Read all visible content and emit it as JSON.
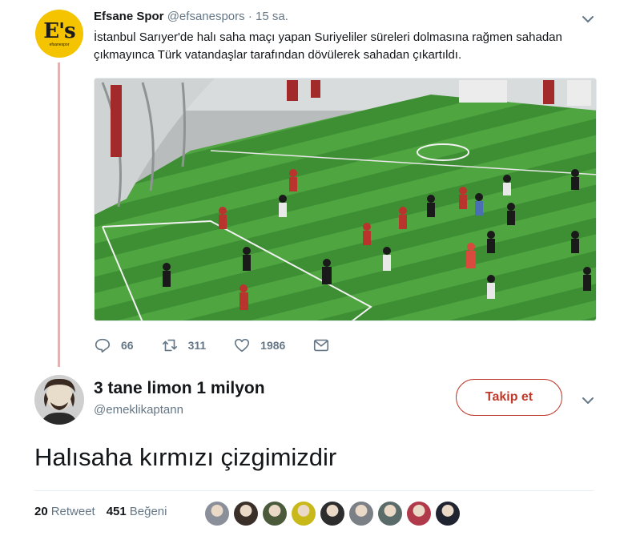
{
  "parent_tweet": {
    "avatar_logo": "E's",
    "avatar_logo_sub": "efsanespor",
    "display_name": "Efsane Spor",
    "handle": "@efsanespors",
    "separator": "·",
    "time": "15 sa.",
    "text": "İstanbul Sarıyer'de halı saha maçı yapan Suriyeliler süreleri dolmasına rağmen sahadan çıkmayınca Türk vatandaşlar tarafından dövülerek sahadan çıkartıldı.",
    "media_icon": "football-field-video-still",
    "actions": {
      "reply_count": "66",
      "retweet_count": "311",
      "like_count": "1986"
    },
    "thread_line_color": "#e2b3b3"
  },
  "main_tweet": {
    "display_name": "3 tane limon 1 milyon",
    "handle": "@emeklikaptann",
    "follow_label": "Takip et",
    "text": "Halısaha kırmızı çizgimizdir",
    "retweet_count": "20",
    "retweet_label": "Retweet",
    "like_count": "451",
    "like_label": "Beğeni",
    "accent_color": "#c0392b",
    "likers": [
      {
        "color": "#8a8f99"
      },
      {
        "color": "#3b2f2a"
      },
      {
        "color": "#4a5a3a"
      },
      {
        "color": "#c9b81a"
      },
      {
        "color": "#2d2d2d"
      },
      {
        "color": "#7b7f86"
      },
      {
        "color": "#5a6b6a"
      },
      {
        "color": "#b0394a"
      },
      {
        "color": "#1f2430"
      }
    ]
  }
}
